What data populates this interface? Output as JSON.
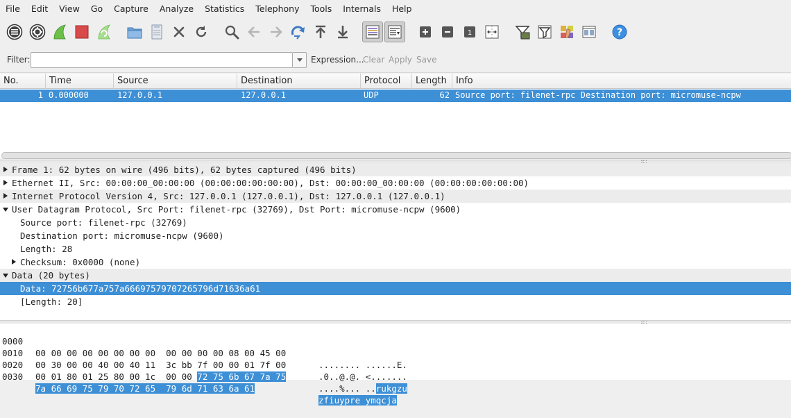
{
  "menu": [
    "File",
    "Edit",
    "View",
    "Go",
    "Capture",
    "Analyze",
    "Statistics",
    "Telephony",
    "Tools",
    "Internals",
    "Help"
  ],
  "toolbar": {
    "icons": [
      "interface-list-icon",
      "capture-options-icon",
      "start-capture-icon",
      "stop-capture-icon",
      "restart-capture-icon",
      "open-file-icon",
      "save-file-icon",
      "close-file-icon",
      "reload-icon",
      "find-packet-icon",
      "go-back-icon",
      "go-forward-icon",
      "go-to-packet-icon",
      "first-packet-icon",
      "last-packet-icon",
      "colorize-icon",
      "auto-scroll-icon",
      "zoom-in-icon",
      "zoom-out-icon",
      "normal-size-icon",
      "resize-columns-icon",
      "capture-filters-icon",
      "display-filters-icon",
      "coloring-rules-icon",
      "preferences-icon",
      "help-icon"
    ]
  },
  "filter": {
    "label": "Filter:",
    "value": "",
    "expression": "Expression...",
    "clear": "Clear",
    "apply": "Apply",
    "save": "Save"
  },
  "packet_list": {
    "columns": [
      "No.",
      "Time",
      "Source",
      "Destination",
      "Protocol",
      "Length",
      "Info"
    ],
    "rows": [
      {
        "no": "1",
        "time": "0.000000",
        "source": "127.0.0.1",
        "destination": "127.0.0.1",
        "protocol": "UDP",
        "length": "62",
        "info": "Source port: filenet-rpc  Destination port: micromuse-ncpw"
      }
    ]
  },
  "details": [
    {
      "text": "Frame 1: 62 bytes on wire (496 bits), 62 bytes captured (496 bits)",
      "expander": "collapsed",
      "level": 0
    },
    {
      "text": "Ethernet II, Src: 00:00:00_00:00:00 (00:00:00:00:00:00), Dst: 00:00:00_00:00:00 (00:00:00:00:00:00)",
      "expander": "collapsed",
      "level": 0
    },
    {
      "text": "Internet Protocol Version 4, Src: 127.0.0.1 (127.0.0.1), Dst: 127.0.0.1 (127.0.0.1)",
      "expander": "collapsed",
      "level": 0
    },
    {
      "text": "User Datagram Protocol, Src Port: filenet-rpc (32769), Dst Port: micromuse-ncpw (9600)",
      "expander": "expanded",
      "level": 0
    },
    {
      "text": "Source port: filenet-rpc (32769)",
      "expander": "none",
      "level": 1
    },
    {
      "text": "Destination port: micromuse-ncpw (9600)",
      "expander": "none",
      "level": 1
    },
    {
      "text": "Length: 28",
      "expander": "none",
      "level": 1
    },
    {
      "text": "Checksum: 0x0000 (none)",
      "expander": "collapsed",
      "level": 1
    },
    {
      "text": "Data (20 bytes)",
      "expander": "expanded",
      "level": 0
    },
    {
      "text": "Data: 72756b677a757a66697579707265796d71636a61",
      "expander": "none",
      "level": 1,
      "selected": true
    },
    {
      "text": "[Length: 20]",
      "expander": "none",
      "level": 1
    }
  ],
  "bytes": [
    {
      "offset": "0000",
      "hex_plain": "00 00 00 00 00 00 00 00  00 00 00 00 08 00 45 00",
      "hex_hl": "",
      "ascii_plain": "........ ......E.",
      "ascii_hl": ""
    },
    {
      "offset": "0010",
      "hex_plain": "00 30 00 00 40 00 40 11  3c bb 7f 00 00 01 7f 00",
      "hex_hl": "",
      "ascii_plain": ".0..@.@. <.......",
      "ascii_hl": ""
    },
    {
      "offset": "0020",
      "hex_plain": "00 01 80 01 25 80 00 1c  00 00 ",
      "hex_hl": "72 75 6b 67 7a 75",
      "ascii_plain": "....%... ..",
      "ascii_hl": "rukgzu"
    },
    {
      "offset": "0030",
      "hex_plain": "",
      "hex_hl": "7a 66 69 75 79 70 72 65  79 6d 71 63 6a 61",
      "ascii_plain": "",
      "ascii_hl": "zfiuypre ymqcja"
    }
  ],
  "colors": {
    "selection": "#3d8fd6",
    "alt_row": "#ececec"
  }
}
